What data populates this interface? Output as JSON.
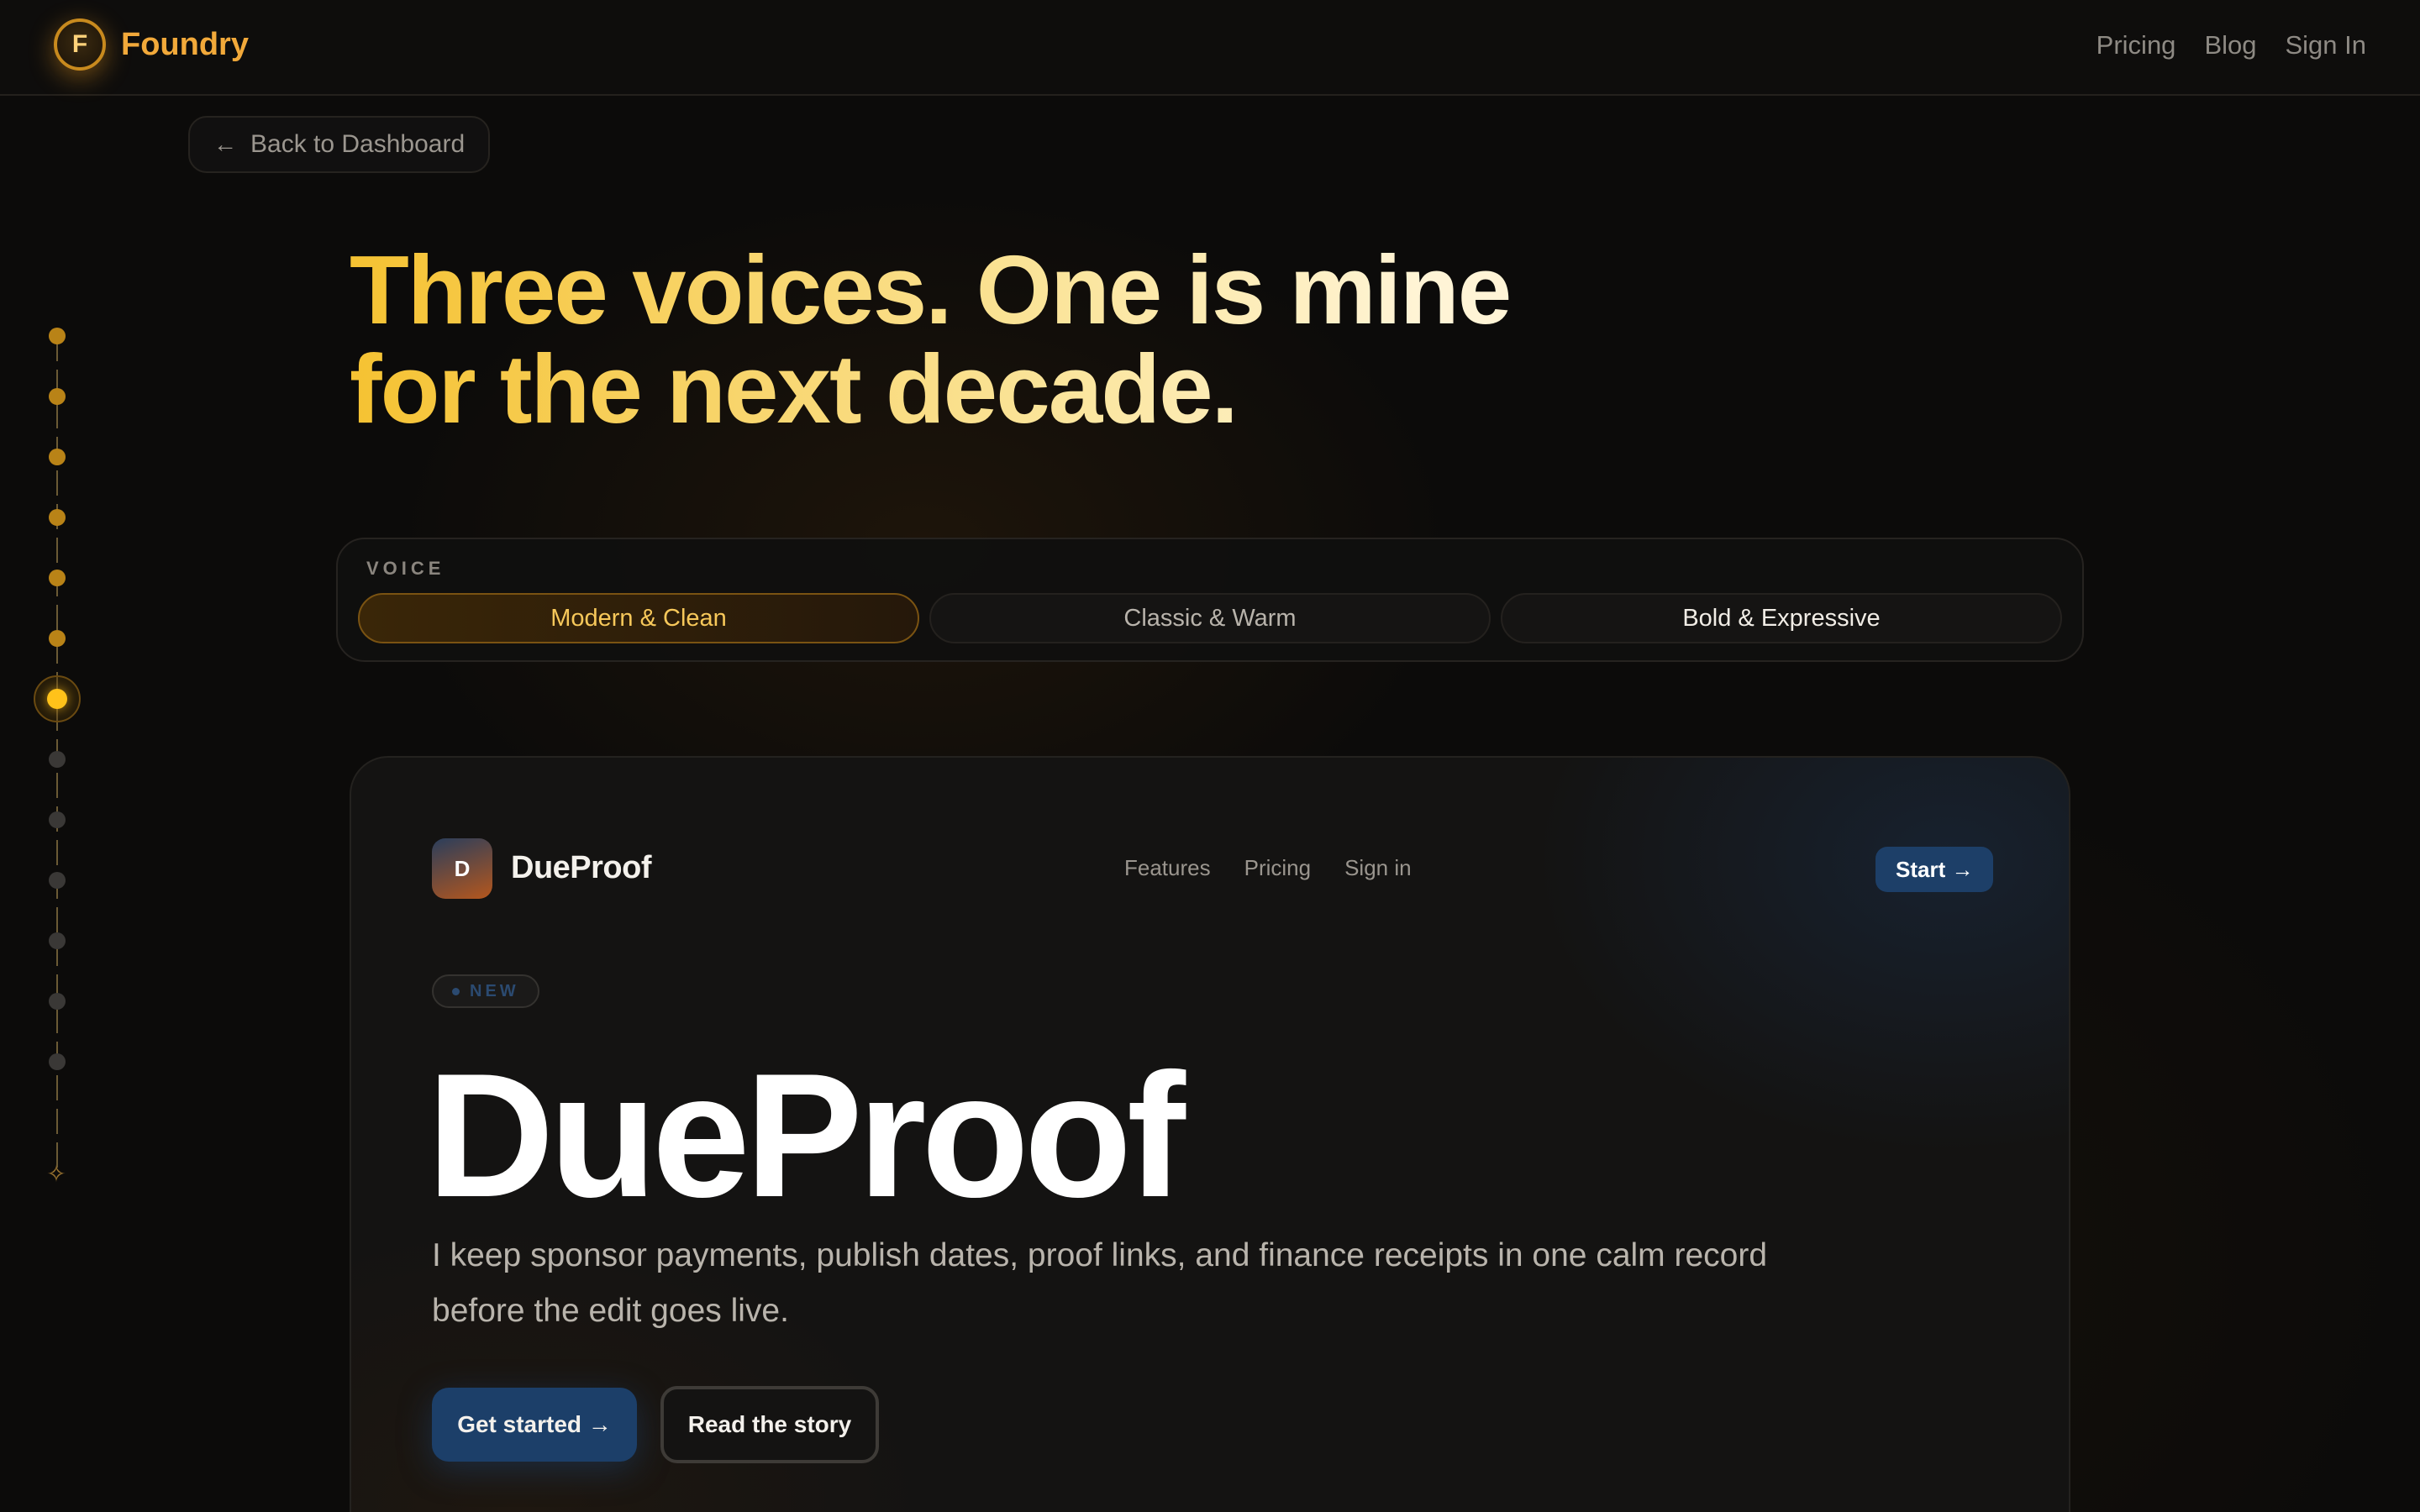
{
  "app": {
    "brand_initial": "F",
    "brand_name": "Foundry",
    "accent_color": "#f2a93a"
  },
  "topnav": {
    "links": [
      "Pricing",
      "Blog",
      "Sign In"
    ]
  },
  "back_button": {
    "icon": "arrow-left-icon",
    "label": "Back to Dashboard"
  },
  "timeline": {
    "completed_steps": 6,
    "active_step": 7,
    "total_steps": 13,
    "end_icon": "sparkle-icon"
  },
  "headline": {
    "line1": "Three voices. One is mine",
    "line2": "for the next decade."
  },
  "voice": {
    "label": "VOICE",
    "options": [
      "Modern & Clean",
      "Classic & Warm",
      "Bold & Expressive"
    ],
    "selected": "Modern & Clean"
  },
  "preview": {
    "logo_initial": "D",
    "brand_name": "DueProof",
    "nav": [
      "Features",
      "Pricing",
      "Sign in"
    ],
    "start_label": "Start →",
    "badge": "NEW",
    "title": "DueProof",
    "description": "I keep sponsor payments, publish dates, proof links, and finance receipts in one calm record before the edit goes live.",
    "cta_primary": "Get started →",
    "cta_secondary": "Read the story",
    "primary_color": "#1c3f69"
  }
}
